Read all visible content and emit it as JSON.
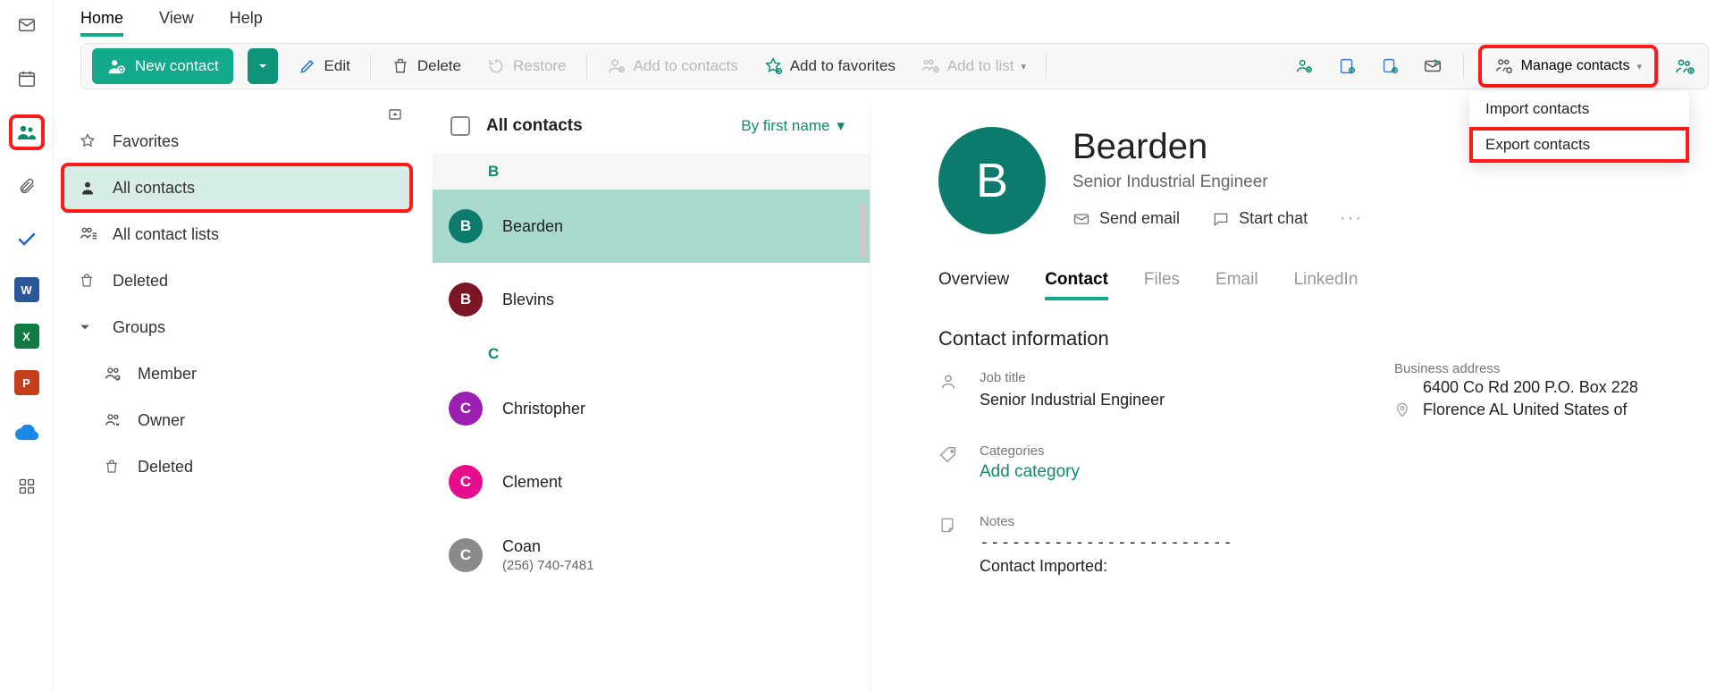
{
  "topmenu": {
    "home": "Home",
    "view": "View",
    "help": "Help"
  },
  "ribbon": {
    "new_contact": "New contact",
    "edit": "Edit",
    "delete": "Delete",
    "restore": "Restore",
    "add_to_contacts": "Add to contacts",
    "add_to_favorites": "Add to favorites",
    "add_to_list": "Add to list",
    "manage_contacts": "Manage contacts"
  },
  "dropdown": {
    "import": "Import contacts",
    "export": "Export contacts"
  },
  "folders": {
    "favorites": "Favorites",
    "all_contacts": "All contacts",
    "all_contact_lists": "All contact lists",
    "deleted": "Deleted",
    "groups": "Groups",
    "member": "Member",
    "owner": "Owner",
    "g_deleted": "Deleted"
  },
  "clist": {
    "title": "All contacts",
    "sort": "By first name",
    "letters": {
      "b": "B",
      "c": "C"
    },
    "items": [
      {
        "initial": "B",
        "name": "Bearden",
        "color": "#0c7b6e"
      },
      {
        "initial": "B",
        "name": "Blevins",
        "color": "#7c1626"
      },
      {
        "initial": "C",
        "name": "Christopher",
        "color": "#9b1fb0"
      },
      {
        "initial": "C",
        "name": "Clement",
        "color": "#e60f8b"
      },
      {
        "initial": "C",
        "name": "Coan",
        "sub": "(256) 740-7481",
        "color": "#8a8a8a"
      }
    ]
  },
  "detail": {
    "initial": "B",
    "name": "Bearden",
    "job": "Senior Industrial Engineer",
    "send_email": "Send email",
    "start_chat": "Start chat",
    "tabs": {
      "overview": "Overview",
      "contact": "Contact",
      "files": "Files",
      "email": "Email",
      "linkedin": "LinkedIn"
    },
    "section_title": "Contact information",
    "job_label": "Job title",
    "job_value": "Senior Industrial Engineer",
    "addr_label": "Business address",
    "addr_value": "6400 Co Rd 200 P.O. Box 228 Florence AL United States of",
    "cat_label": "Categories",
    "add_category": "Add category",
    "notes_label": "Notes",
    "notes_dash": "------------------------",
    "notes_value": "Contact Imported:"
  }
}
